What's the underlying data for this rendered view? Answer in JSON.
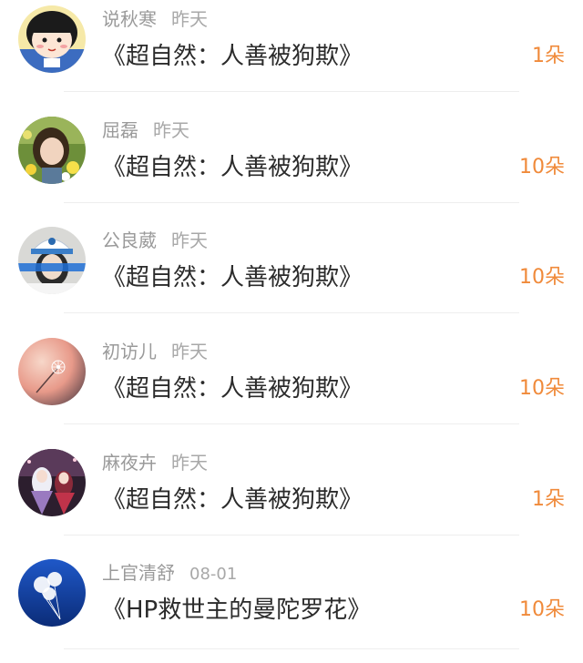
{
  "list": {
    "items": [
      {
        "name": "说秋寒",
        "time": "昨天",
        "title": "《超自然：人善被狗欺》",
        "flowers": "1朵",
        "avatar_icon": "chibi-girl-avatar-icon"
      },
      {
        "name": "屈磊",
        "time": "昨天",
        "title": "《超自然：人善被狗欺》",
        "flowers": "10朵",
        "avatar_icon": "girl-flowers-avatar-icon"
      },
      {
        "name": "公良葳",
        "time": "昨天",
        "title": "《超自然：人善被狗欺》",
        "flowers": "10朵",
        "avatar_icon": "cap-girl-avatar-icon"
      },
      {
        "name": "初访儿",
        "time": "昨天",
        "title": "《超自然：人善被狗欺》",
        "flowers": "10朵",
        "avatar_icon": "dandelion-avatar-icon"
      },
      {
        "name": "麻夜卉",
        "time": "昨天",
        "title": "《超自然：人善被狗欺》",
        "flowers": "1朵",
        "avatar_icon": "anime-characters-avatar-icon"
      },
      {
        "name": "上官清舒",
        "time": "08-01",
        "title": "《HP救世主的曼陀罗花》",
        "flowers": "10朵",
        "avatar_icon": "balloons-sky-avatar-icon"
      }
    ]
  },
  "colors": {
    "flower_count": "#f08a3a",
    "name_text": "#9a9a9a",
    "title_text": "#2b2b2b",
    "divider": "#eeeeee"
  }
}
